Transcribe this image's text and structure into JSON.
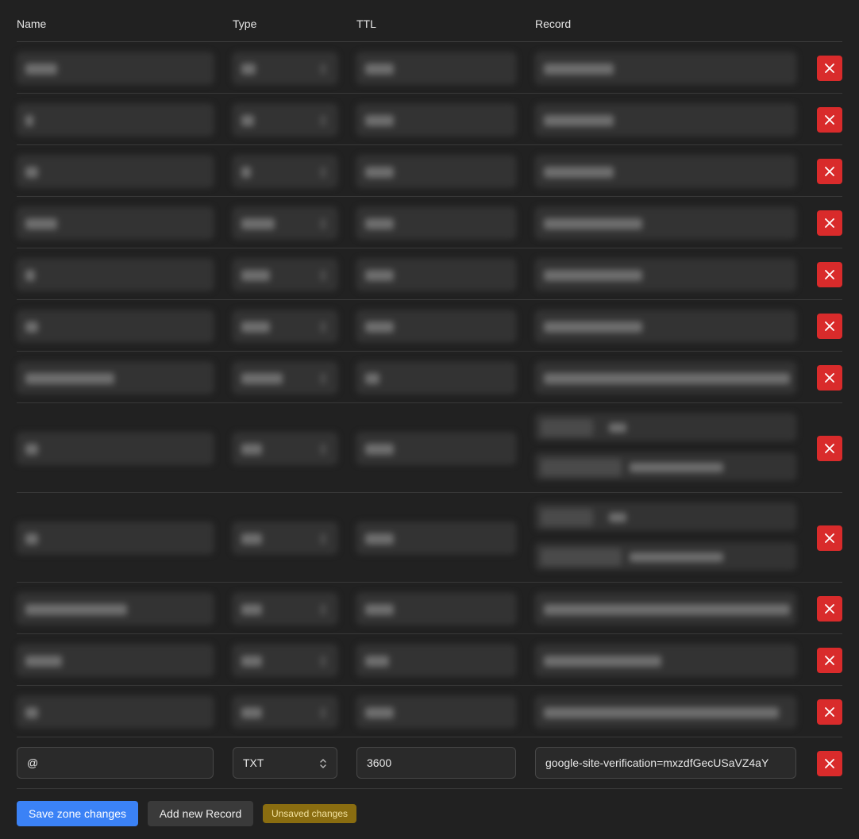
{
  "columns": {
    "name": "Name",
    "type": "Type",
    "ttl": "TTL",
    "record": "Record"
  },
  "records_redacted": [
    {
      "row": 1,
      "blurred": true
    },
    {
      "row": 2,
      "blurred": true
    },
    {
      "row": 3,
      "blurred": true
    },
    {
      "row": 4,
      "blurred": true
    },
    {
      "row": 5,
      "blurred": true
    },
    {
      "row": 6,
      "blurred": true
    },
    {
      "row": 7,
      "blurred": true
    },
    {
      "row": 8,
      "blurred": true,
      "multi_value": true
    },
    {
      "row": 9,
      "blurred": true,
      "multi_value": true
    },
    {
      "row": 10,
      "blurred": true
    },
    {
      "row": 11,
      "blurred": true
    },
    {
      "row": 12,
      "blurred": true
    }
  ],
  "new_record": {
    "name": "@",
    "type": "TXT",
    "ttl": "3600",
    "record": "google-site-verification=mxzdfGecUSaVZ4aY"
  },
  "footer": {
    "save_label": "Save zone changes",
    "add_label": "Add new Record",
    "status_badge": "Unsaved changes"
  },
  "colors": {
    "background": "#212121",
    "delete_button": "#d92b2b",
    "save_button": "#3b82f6",
    "badge": "#8a6d10"
  },
  "icons": [
    "close-icon",
    "chevron-up-down-icon"
  ]
}
